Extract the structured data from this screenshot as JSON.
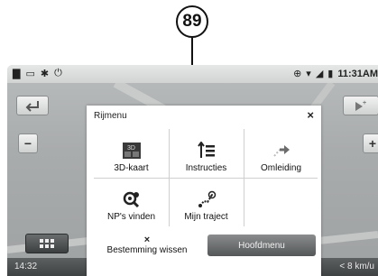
{
  "callout": {
    "number": "89"
  },
  "statusbar": {
    "time": "11:31AM"
  },
  "menu": {
    "title": "Rijmenu",
    "close_symbol": "×",
    "tiles": [
      {
        "label": "3D-kaart",
        "icon": "3d-map-icon"
      },
      {
        "label": "Instructies",
        "icon": "instructions-list-icon"
      },
      {
        "label": "Omleiding",
        "icon": "detour-arrow-icon"
      },
      {
        "label": "NP's vinden",
        "icon": "find-poi-icon"
      },
      {
        "label": "Mijn traject",
        "icon": "route-path-icon"
      }
    ],
    "clear_destination": {
      "symbol": "×",
      "label": "Bestemming wissen"
    },
    "main_menu_button": "Hoofdmenu"
  },
  "bottom": {
    "time": "14:32",
    "speed": "< 8 km/u"
  }
}
